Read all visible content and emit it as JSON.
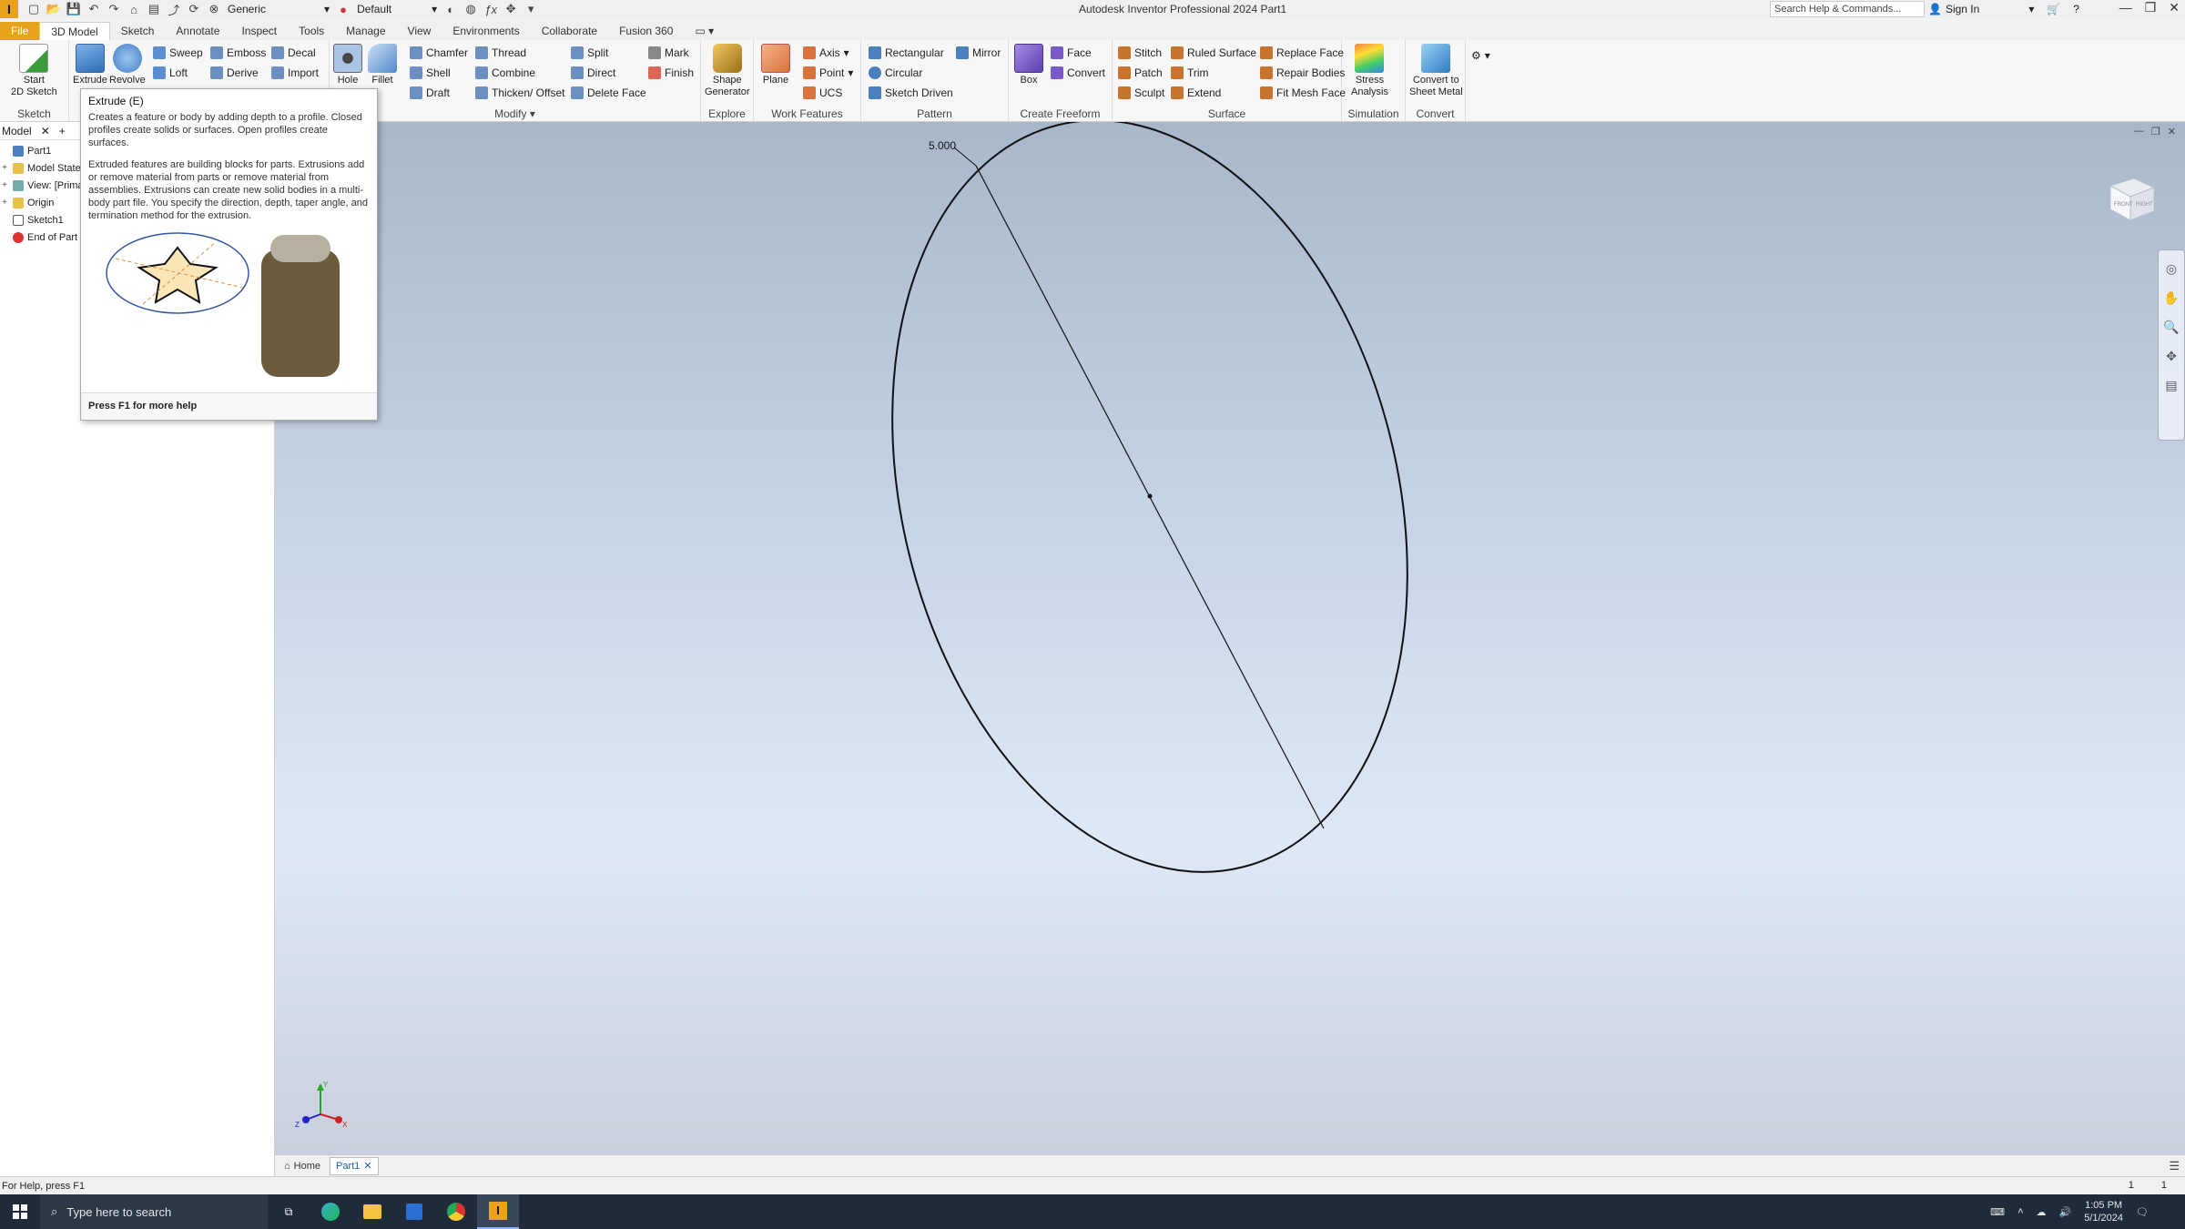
{
  "app": {
    "title": "Autodesk Inventor Professional 2024   Part1",
    "logo_letter": "I",
    "material": "Generic",
    "appearance": "Default",
    "search_placeholder": "Search Help & Commands...",
    "sign_in": "Sign In"
  },
  "menu_tabs": [
    "File",
    "3D Model",
    "Sketch",
    "Annotate",
    "Inspect",
    "Tools",
    "Manage",
    "View",
    "Environments",
    "Collaborate",
    "Fusion 360"
  ],
  "ribbon": {
    "sketch_group": {
      "label": "Sketch",
      "start_sketch": "Start\n2D Sketch"
    },
    "create_group": {
      "extrude": "Extrude",
      "revolve": "Revolve",
      "sweep": "Sweep",
      "emboss": "Emboss",
      "decal": "Decal",
      "loft": "Loft",
      "derive": "Derive",
      "import": "Import"
    },
    "modify_group": {
      "label": "Modify",
      "hole": "Hole",
      "fillet": "Fillet",
      "chamfer": "Chamfer",
      "shell": "Shell",
      "draft": "Draft",
      "thread": "Thread",
      "combine": "Combine",
      "thicken": "Thicken/ Offset",
      "split": "Split",
      "direct": "Direct",
      "delete_face": "Delete Face",
      "mark": "Mark",
      "finish": "Finish"
    },
    "explore_group": {
      "label": "Explore",
      "shape_generator": "Shape\nGenerator"
    },
    "work_features": {
      "label": "Work Features",
      "plane": "Plane",
      "axis": "Axis",
      "point": "Point",
      "ucs": "UCS"
    },
    "pattern": {
      "label": "Pattern",
      "rectangular": "Rectangular",
      "circular": "Circular",
      "sketch_driven": "Sketch Driven",
      "mirror": "Mirror"
    },
    "create_freeform": {
      "label": "Create Freeform",
      "box": "Box",
      "face": "Face",
      "convert": "Convert"
    },
    "surface": {
      "label": "Surface",
      "stitch": "Stitch",
      "patch": "Patch",
      "sculpt": "Sculpt",
      "ruled_surface": "Ruled Surface",
      "trim": "Trim",
      "extend": "Extend",
      "replace_face": "Replace Face",
      "repair_bodies": "Repair Bodies",
      "fit_mesh_face": "Fit Mesh Face"
    },
    "simulation": {
      "label": "Simulation",
      "stress_analysis": "Stress\nAnalysis"
    },
    "convert": {
      "label": "Convert",
      "to_sheet_metal": "Convert to\nSheet Metal"
    }
  },
  "tooltip": {
    "title": "Extrude (E)",
    "para1": "Creates a feature or body by adding depth to a profile. Closed profiles create solids or surfaces. Open profiles create surfaces.",
    "para2": "Extruded features are building blocks for parts. Extrusions add or remove material from parts or remove material from assemblies. Extrusions can create new solid bodies in a multi-body part file. You specify the direction, depth, taper angle, and termination method for the extrusion.",
    "footer": "Press F1 for more help"
  },
  "browser": {
    "tab_label": "Model",
    "items": [
      {
        "label": "Part1",
        "expander": ""
      },
      {
        "label": "Model States",
        "expander": "+"
      },
      {
        "label": "View: [Prima",
        "expander": "+"
      },
      {
        "label": "Origin",
        "expander": "+"
      },
      {
        "label": "Sketch1",
        "expander": ""
      },
      {
        "label": "End of Part",
        "expander": ""
      }
    ]
  },
  "viewport": {
    "dimension_label": "5.000",
    "viewcube_faces": [
      "FRONT",
      "RIGHT"
    ],
    "axis_labels": [
      "Y",
      "Z",
      "X"
    ]
  },
  "doc_tabs": [
    "Home",
    "Part1"
  ],
  "status": {
    "help_text": "For Help, press F1",
    "counter_left": "1",
    "counter_right": "1"
  },
  "taskbar": {
    "search_placeholder": "Type here to search",
    "time": "1:05 PM",
    "date": "5/1/2024"
  },
  "colors": {
    "accent_file": "#e8a21b",
    "taskbar_bg": "#1f2a3a",
    "viewport_top": "#a9b7cb",
    "viewport_mid": "#dfe8f5"
  }
}
